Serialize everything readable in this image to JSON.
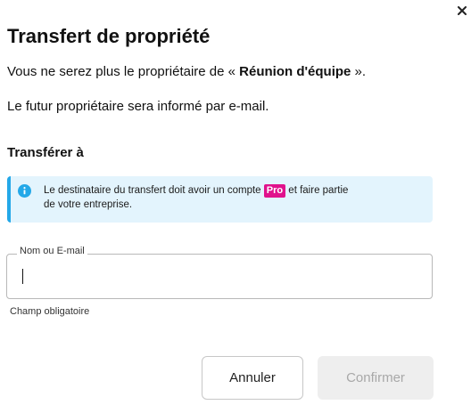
{
  "dialog": {
    "title": "Transfert de propriété",
    "line1_prefix": "Vous ne serez plus le propriétaire de « ",
    "meeting_name": "Réunion d'équipe",
    "line1_suffix": " ».",
    "line2": "Le futur propriétaire sera informé par e-mail.",
    "section_label": "Transférer à",
    "info": {
      "icon": "info-icon",
      "text_before": "Le destinataire du transfert doit avoir un compte ",
      "pro_badge": "Pro",
      "text_after": " et faire partie",
      "text_line2": "de votre entreprise."
    },
    "field": {
      "label": "Nom ou E-mail",
      "value": "",
      "helper": "Champ obligatoire"
    },
    "buttons": {
      "cancel": "Annuler",
      "confirm": "Confirmer"
    },
    "close_icon": "close-icon"
  },
  "colors": {
    "info_bg": "#e3f4fd",
    "info_accent": "#24a8e8",
    "pro_badge": "#e0128c",
    "confirm_disabled_bg": "#eeeeee",
    "confirm_disabled_text": "#a8a8a8"
  }
}
